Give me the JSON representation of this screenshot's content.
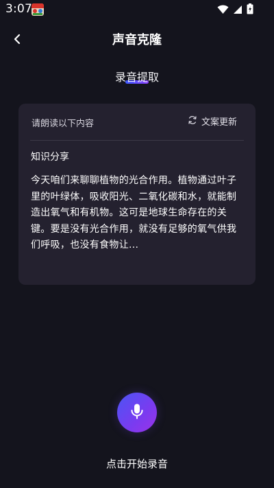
{
  "status_bar": {
    "time": "3:07",
    "icons": [
      "app-notification-icon",
      "wifi-icon",
      "signal-icon",
      "battery-icon"
    ]
  },
  "header": {
    "title": "声音克隆",
    "back_icon": "chevron-left-icon"
  },
  "tab": {
    "label": "录音提取"
  },
  "card": {
    "instruction": "请朗读以下内容",
    "refresh_label": "文案更新",
    "refresh_icon": "refresh-icon",
    "subtitle": "知识分享",
    "body": "今天咱们来聊聊植物的光合作用。植物通过叶子里的叶绿体，吸收阳光、二氧化碳和水，就能制造出氧气和有机物。这可是地球生命存在的关键。要是没有光合作用，就没有足够的氧气供我们呼吸，也没有食物让..."
  },
  "record": {
    "mic_icon": "microphone-icon",
    "hint": "点击开始录音"
  },
  "colors": {
    "background": "#14141d",
    "card": "#24212f",
    "accent_start": "#3e5bff",
    "accent_end": "#8a3dff"
  }
}
